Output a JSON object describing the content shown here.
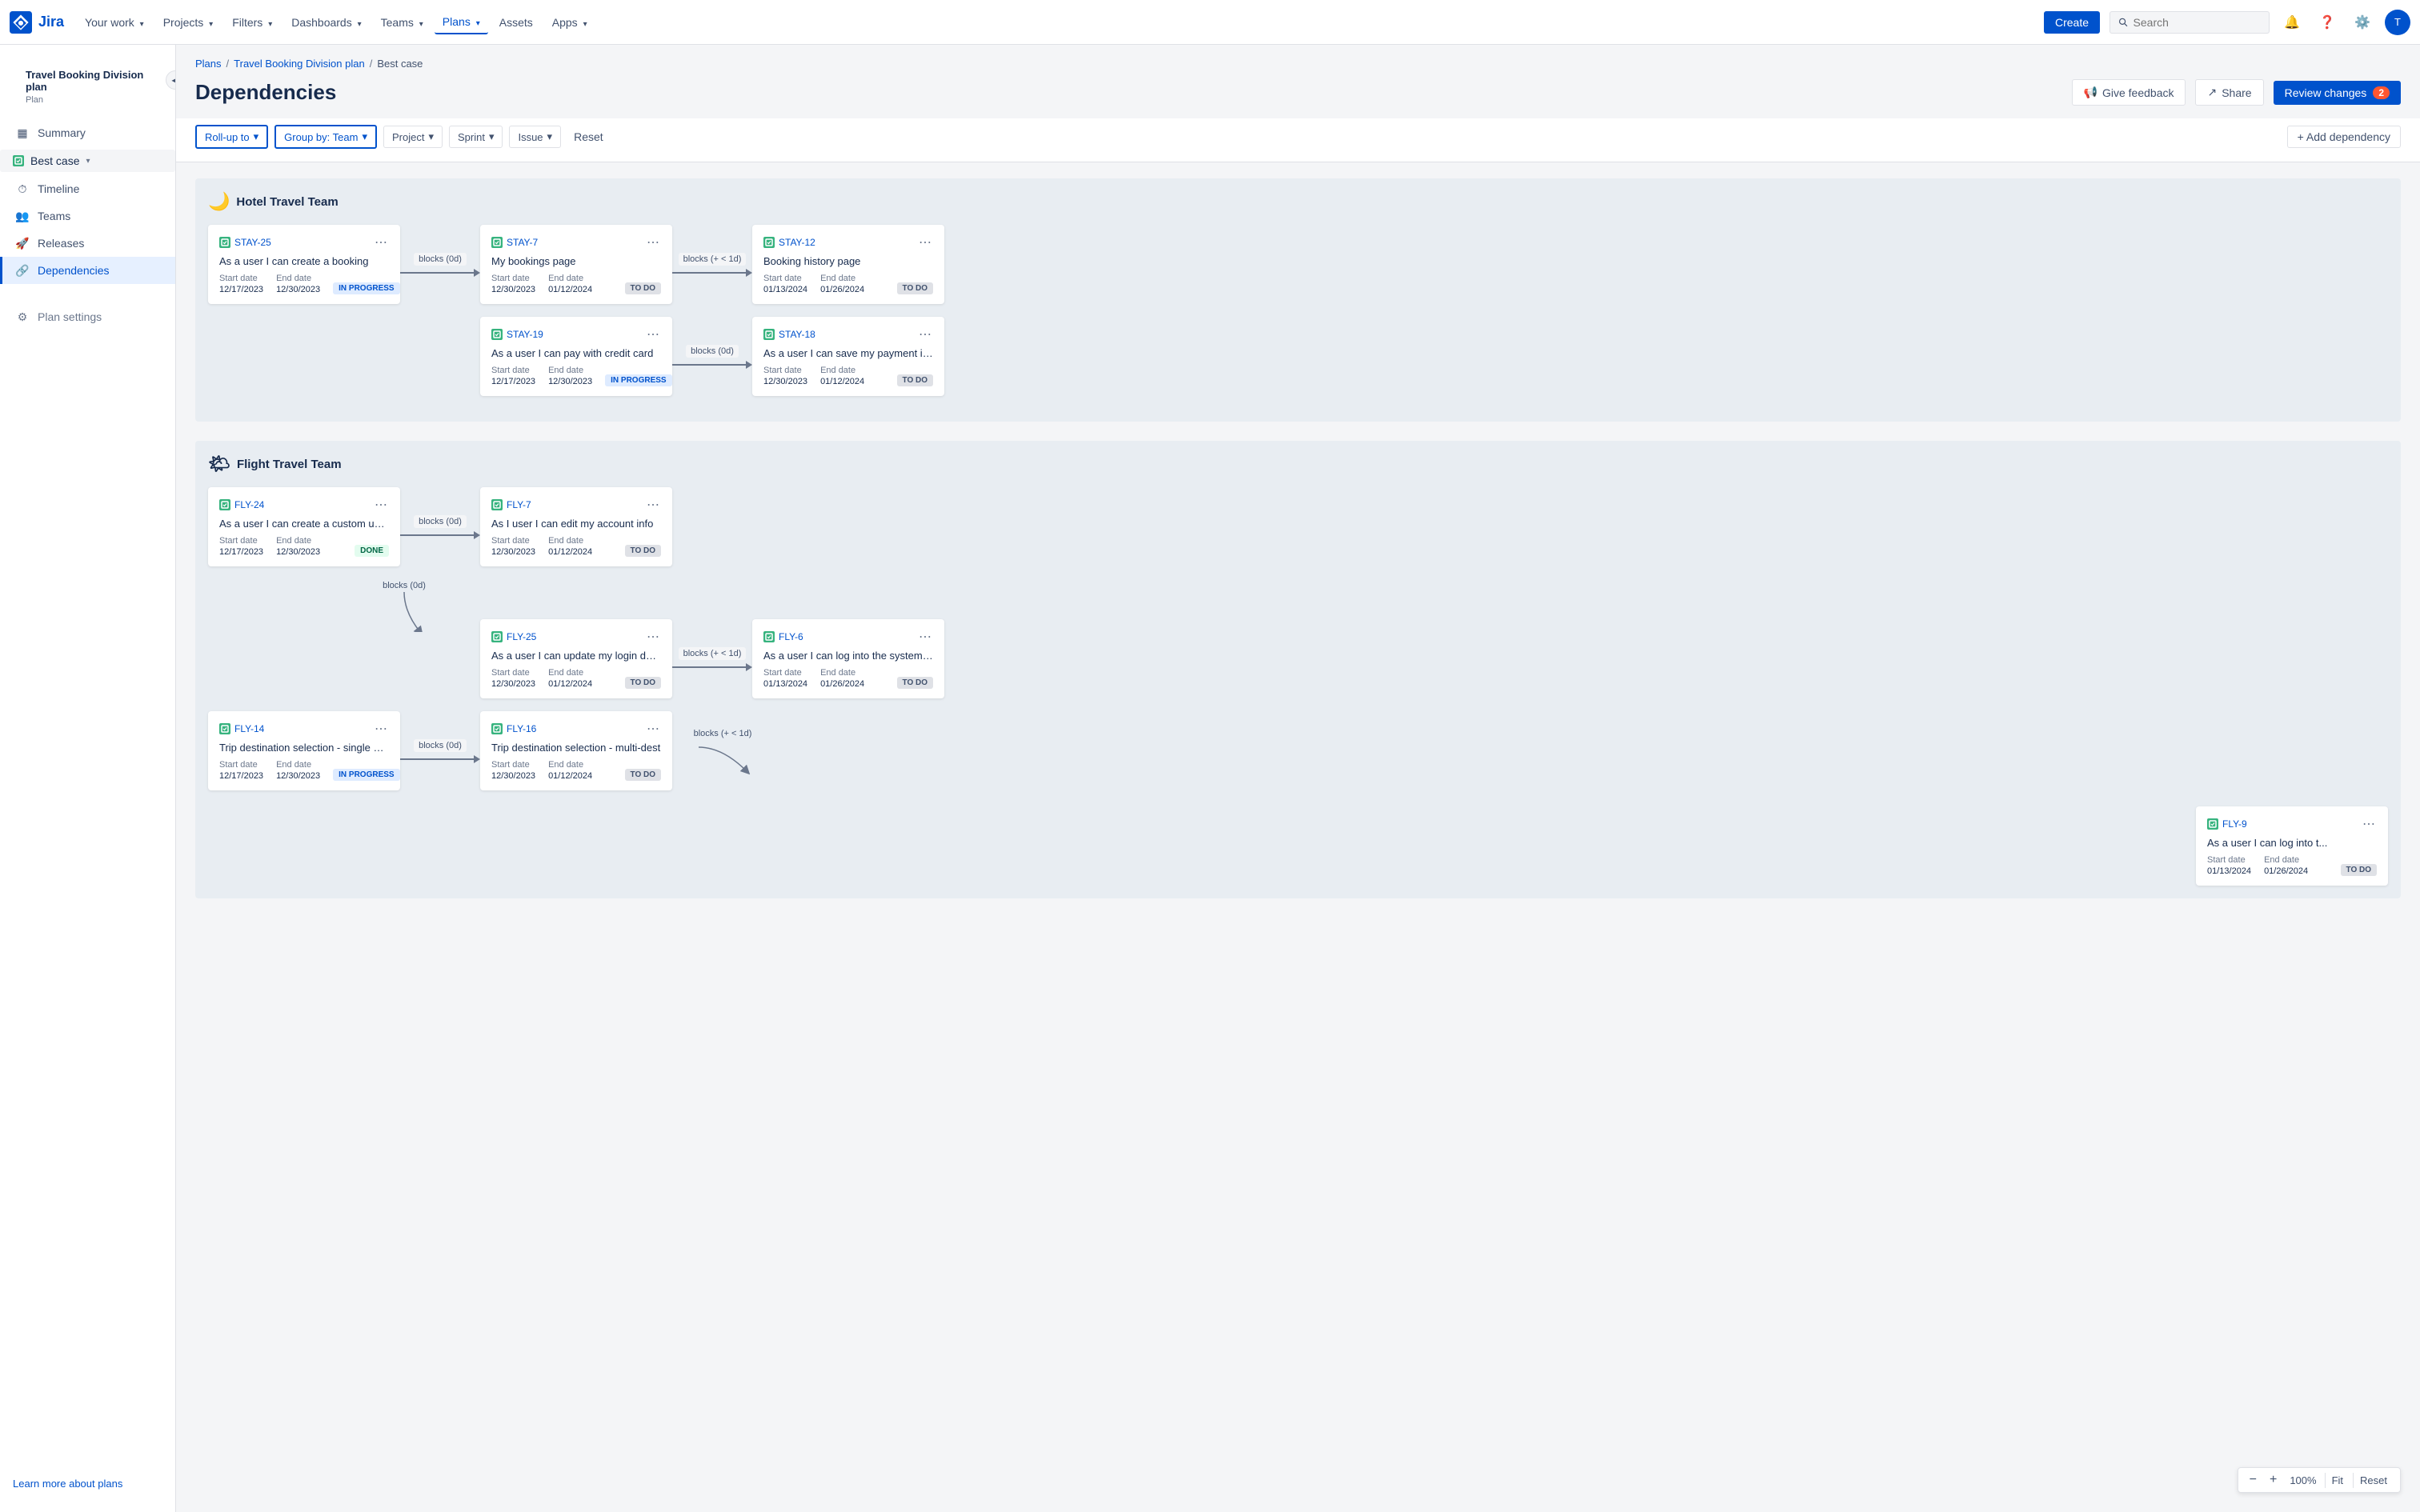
{
  "app": {
    "logo_text": "Jira",
    "nav_items": [
      {
        "label": "Your work",
        "has_chevron": true
      },
      {
        "label": "Projects",
        "has_chevron": true
      },
      {
        "label": "Filters",
        "has_chevron": true
      },
      {
        "label": "Dashboards",
        "has_chevron": true
      },
      {
        "label": "Teams",
        "has_chevron": true
      },
      {
        "label": "Plans",
        "has_chevron": true,
        "active": true
      },
      {
        "label": "Assets"
      },
      {
        "label": "Apps",
        "has_chevron": true
      }
    ],
    "create_label": "Create",
    "search_placeholder": "Search",
    "avatar_text": "T"
  },
  "sidebar": {
    "plan_title": "Travel Booking Division plan",
    "plan_sub": "Plan",
    "summary_label": "Summary",
    "scenario": {
      "label": "Best case",
      "has_chevron": true
    },
    "nav_items": [
      {
        "label": "Timeline",
        "icon": "timeline"
      },
      {
        "label": "Teams",
        "icon": "teams"
      },
      {
        "label": "Releases",
        "icon": "releases"
      },
      {
        "label": "Dependencies",
        "icon": "dependencies",
        "active": true
      }
    ],
    "settings_label": "Plan settings",
    "footer_label": "Learn more about plans"
  },
  "breadcrumb": {
    "items": [
      "Plans",
      "Travel Booking Division plan",
      "Best case"
    ]
  },
  "page": {
    "title": "Dependencies",
    "give_feedback_label": "Give feedback",
    "share_label": "Share",
    "review_changes_label": "Review changes",
    "review_changes_count": "2"
  },
  "filters": {
    "rollup_label": "Roll-up to",
    "groupby_label": "Group by: Team",
    "project_label": "Project",
    "sprint_label": "Sprint",
    "issue_label": "Issue",
    "reset_label": "Reset",
    "add_dep_label": "+ Add dependency"
  },
  "teams": [
    {
      "name": "Hotel Travel Team",
      "emoji": "🌙",
      "rows": [
        {
          "type": "straight",
          "from": {
            "id": "STAY-25",
            "title": "As a user I can create a booking",
            "start_date": "12/17/2023",
            "end_date": "12/30/2023",
            "status": "IN PROGRESS",
            "status_type": "in-progress"
          },
          "connector": "blocks (0d)",
          "to": {
            "id": "STAY-7",
            "title": "My bookings page",
            "start_date": "12/30/2023",
            "end_date": "01/12/2024",
            "status": "TO DO",
            "status_type": "to-do"
          },
          "connector2": "blocks (+ < 1d)",
          "to2": {
            "id": "STAY-12",
            "title": "Booking history page",
            "start_date": "01/13/2024",
            "end_date": "01/26/2024",
            "status": "TO DO",
            "status_type": "to-do"
          }
        },
        {
          "type": "straight",
          "offset": true,
          "from": {
            "id": "STAY-19",
            "title": "As a user I can pay with credit card",
            "start_date": "12/17/2023",
            "end_date": "12/30/2023",
            "status": "IN PROGRESS",
            "status_type": "in-progress"
          },
          "connector": "blocks (0d)",
          "to": {
            "id": "STAY-18",
            "title": "As a user I can save my payment inform...",
            "start_date": "12/30/2023",
            "end_date": "01/12/2024",
            "status": "TO DO",
            "status_type": "to-do"
          }
        }
      ]
    },
    {
      "name": "Flight Travel Team",
      "emoji": "✈️",
      "rows": [
        {
          "type": "straight",
          "from": {
            "id": "FLY-24",
            "title": "As a user I can create a custom user acc...",
            "start_date": "12/17/2023",
            "end_date": "12/30/2023",
            "status": "DONE",
            "status_type": "done"
          },
          "connector": "blocks (0d)",
          "to": {
            "id": "FLY-7",
            "title": "As I user I can edit my account info",
            "start_date": "12/30/2023",
            "end_date": "01/12/2024",
            "status": "TO DO",
            "status_type": "to-do"
          }
        },
        {
          "type": "offset",
          "connector": "blocks (0d)",
          "to": {
            "id": "FLY-25",
            "title": "As a user I can update my login details",
            "start_date": "12/30/2023",
            "end_date": "01/12/2024",
            "status": "TO DO",
            "status_type": "to-do"
          },
          "connector2": "blocks (+ < 1d)",
          "to2": {
            "id": "FLY-6",
            "title": "As a user I can log into the system via Fa...",
            "start_date": "01/13/2024",
            "end_date": "01/26/2024",
            "status": "TO DO",
            "status_type": "to-do"
          }
        },
        {
          "type": "straight",
          "from": {
            "id": "FLY-14",
            "title": "Trip destination selection - single dest.",
            "start_date": "12/17/2023",
            "end_date": "12/30/2023",
            "status": "IN PROGRESS",
            "status_type": "in-progress"
          },
          "connector": "blocks (0d)",
          "to": {
            "id": "FLY-16",
            "title": "Trip destination selection - multi-dest",
            "start_date": "12/30/2023",
            "end_date": "01/12/2024",
            "status": "TO DO",
            "status_type": "to-do"
          },
          "connector2": "blocks (+ < 1d)",
          "to2": {
            "id": "FLY-9",
            "title": "As a user I can log into t...",
            "start_date": "01/13/2024",
            "end_date": "01/26/2024",
            "status": "TO DO",
            "status_type": "to-do"
          }
        }
      ]
    }
  ],
  "zoom": {
    "level": "100%",
    "fit_label": "Fit",
    "reset_label": "Reset"
  }
}
